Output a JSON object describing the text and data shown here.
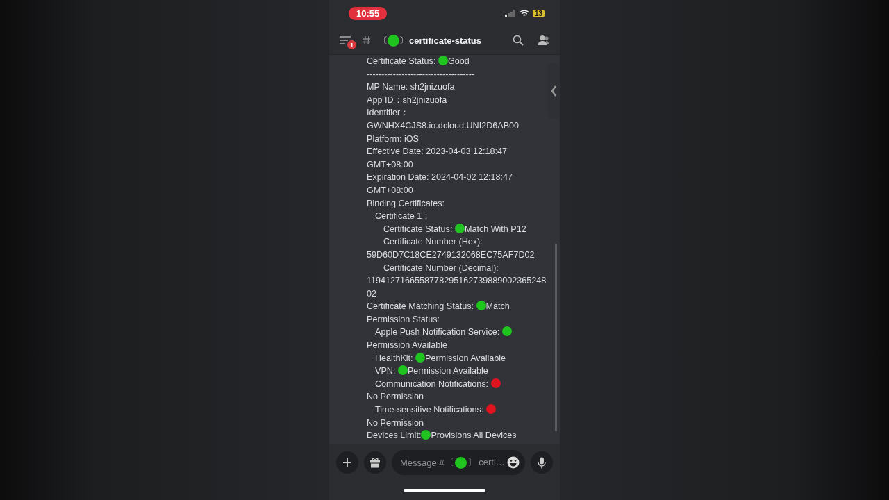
{
  "status_bar": {
    "time": "10:55",
    "battery": "13"
  },
  "header": {
    "badge": "1",
    "prefix": "〔",
    "color": "#1fc41f",
    "suffix": "〕",
    "name": "certificate-status"
  },
  "messages": [
    {
      "text": "Certificate Status: ",
      "color": "#1fc41f",
      "value": "Good"
    },
    {
      "text": "-------------------------------------"
    },
    {
      "text": "MP Name: sh2jnizuofa"
    },
    {
      "text": "App ID：sh2jnizuofa"
    },
    {
      "text": "Identifier：GWNHX4CJS8.io.dcloud.UNI2D6AB00"
    },
    {
      "text": "Platform: iOS"
    },
    {
      "text": "Effective Date: 2023-04-03 12:18:47 GMT+08:00"
    },
    {
      "text": "Expiration Date: 2024-04-02 12:18:47 GMT+08:00"
    },
    {
      "text": "Binding Certificates:",
      "children": [
        {
          "text": "Certificate 1：",
          "children": [
            {
              "text": "Certificate Status: ",
              "color": "#1fc41f",
              "value": "Match With P12"
            },
            {
              "text": "Certificate Number (Hex): 59D60D7C18CE2749132068EC75AF7D02"
            },
            {
              "text": "Certificate Number (Decimal): 119412716655877829516273988900236524802"
            }
          ]
        }
      ]
    },
    {
      "text": "Certificate Matching Status: ",
      "color": "#1fc41f",
      "value": "Match"
    },
    {
      "text": "Permission Status:",
      "children": [
        {
          "text": "Apple Push Notification Service: ",
          "color": "#1fc41f",
          "value": "Permission Available"
        },
        {
          "text": "HealthKit: ",
          "color": "#1fc41f",
          "value": "Permission Available"
        },
        {
          "text": "VPN: ",
          "color": "#1fc41f",
          "value": "Permission Available"
        },
        {
          "text": "Communication Notifications: ",
          "color": "#e0141e",
          "value": "No Permission"
        },
        {
          "text": "Time-sensitive Notifications: ",
          "color": "#e0141e",
          "value": "No Permission"
        }
      ]
    },
    {
      "text": "Devices Limit:",
      "color": "#1fc41f",
      "value": "Provisions All Devices"
    }
  ],
  "composer": {
    "placeholder": "Message #",
    "prefix": "〔",
    "color": "#1fc41f",
    "suffix": "〕 certi…"
  }
}
